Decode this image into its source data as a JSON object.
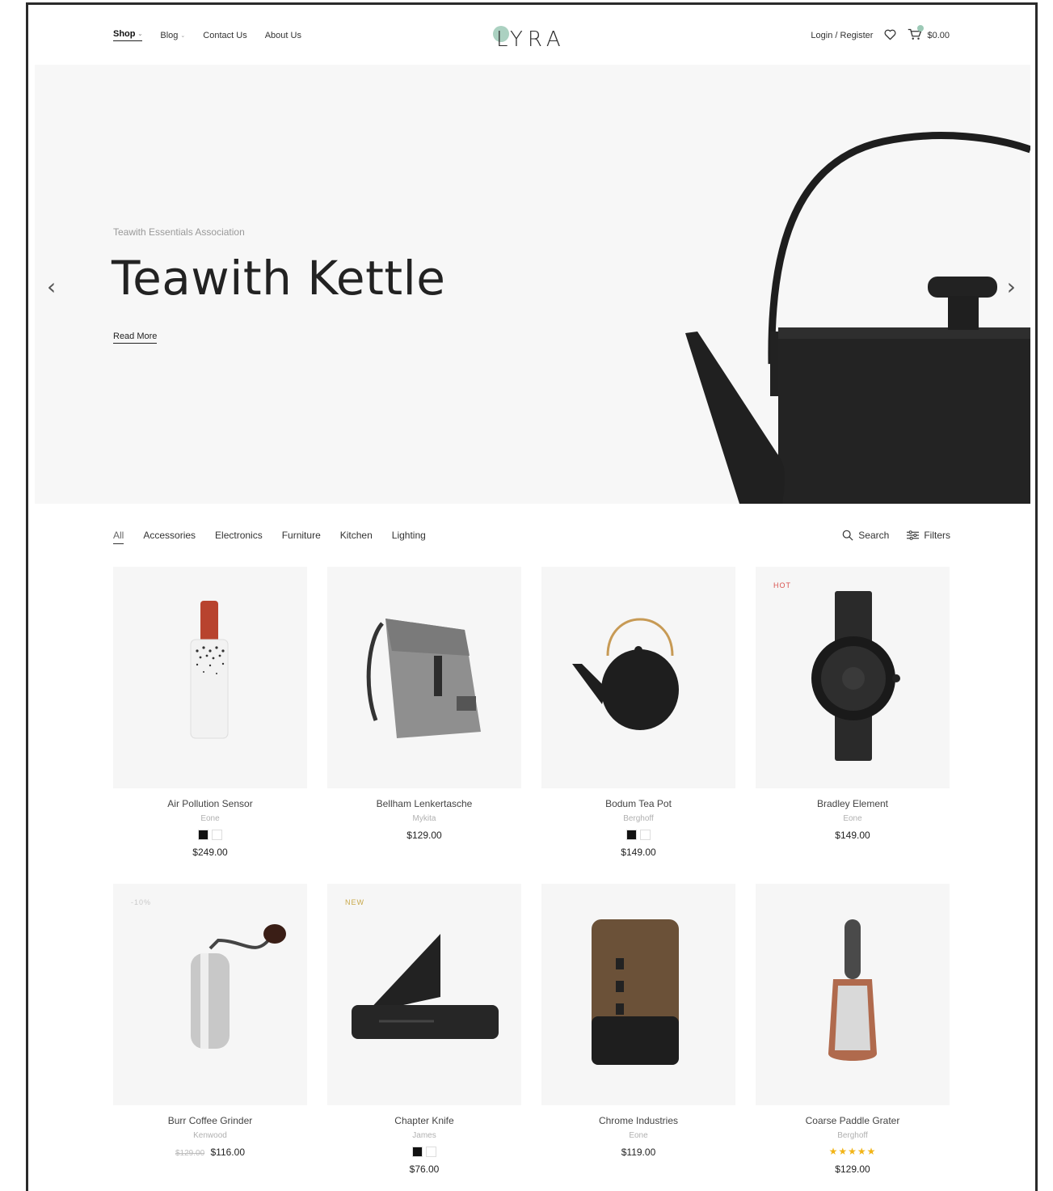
{
  "header": {
    "nav": [
      {
        "label": "Shop",
        "dropdown": true
      },
      {
        "label": "Blog",
        "dropdown": true
      },
      {
        "label": "Contact Us",
        "dropdown": false
      },
      {
        "label": "About Us",
        "dropdown": false
      }
    ],
    "logo": "LYRA",
    "login_label": "Login / Register",
    "cart_total": "$0.00"
  },
  "hero": {
    "subtitle": "Teawith Essentials Association",
    "title": "Teawith Kettle",
    "cta": "Read More"
  },
  "filters": {
    "categories": [
      "All",
      "Accessories",
      "Electronics",
      "Furniture",
      "Kitchen",
      "Lighting"
    ],
    "active": "All",
    "search_label": "Search",
    "filters_label": "Filters"
  },
  "products": [
    {
      "name": "Air Pollution Sensor",
      "brand": "Eone",
      "price": "$249.00",
      "badge": "",
      "swatches": [
        "#111111",
        "#ffffff"
      ],
      "image": "sensor-icon"
    },
    {
      "name": "Bellham Lenkertasche",
      "brand": "Mykita",
      "price": "$129.00",
      "badge": "",
      "swatches": [],
      "image": "backpack-icon"
    },
    {
      "name": "Bodum Tea Pot",
      "brand": "Berghoff",
      "price": "$149.00",
      "badge": "",
      "swatches": [
        "#111111",
        "#ffffff"
      ],
      "image": "teapot-icon"
    },
    {
      "name": "Bradley Element",
      "brand": "Eone",
      "price": "$149.00",
      "badge": "HOT",
      "swatches": [],
      "image": "watch-icon"
    },
    {
      "name": "Burr Coffee Grinder",
      "brand": "Kenwood",
      "price": "$116.00",
      "old_price": "$129.00",
      "badge": "-10%",
      "swatches": [],
      "image": "grinder-icon"
    },
    {
      "name": "Chapter Knife",
      "brand": "James",
      "price": "$76.00",
      "badge": "NEW",
      "swatches": [
        "#111111",
        "#ffffff"
      ],
      "image": "knife-icon"
    },
    {
      "name": "Chrome Industries",
      "brand": "Eone",
      "price": "$119.00",
      "badge": "",
      "swatches": [],
      "image": "rolltop-bag-icon"
    },
    {
      "name": "Coarse Paddle Grater",
      "brand": "Berghoff",
      "price": "$129.00",
      "badge": "",
      "swatches": [],
      "rating": 5,
      "image": "grater-icon"
    }
  ],
  "colors": {
    "accent": "#9cc9b6",
    "hot_badge": "#d9534f",
    "new_badge": "#c8a84a",
    "sale_badge": "#c9c9c9",
    "star": "#f2b417"
  }
}
